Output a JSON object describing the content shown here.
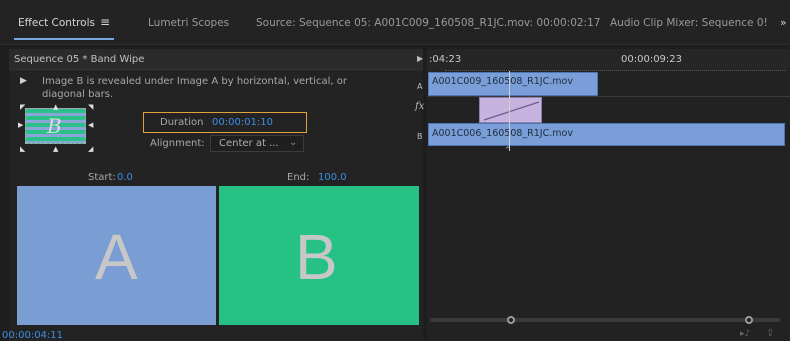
{
  "tabs": {
    "effect_controls": "Effect Controls",
    "menu_glyph": "≡",
    "lumetri": "Lumetri Scopes",
    "source": "Source: Sequence 05: A001C009_160508_R1JC.mov: 00:00:02:17",
    "audio_mixer": "Audio Clip Mixer: Sequence 0!",
    "overflow": "»"
  },
  "effect": {
    "sequence_label": "Sequence 05 * Band Wipe",
    "description": "Image B is revealed under Image A by horizontal, vertical, or diagonal bars.",
    "duration_label": "Duration",
    "duration_value": "00:00:01:10",
    "alignment_label": "Alignment:",
    "alignment_value": "Center at ...",
    "thumbnail_letter": "B",
    "start_label": "Start:",
    "start_value": "0.0",
    "end_label": "End:",
    "end_value": "100.0",
    "preview_a": "A",
    "preview_b": "B",
    "timecode": "00:00:04:11"
  },
  "timeline": {
    "ruler_left": ":04:23",
    "ruler_right": "00:00:09:23",
    "track_a": "A",
    "track_fx": "fx",
    "track_b": "B",
    "clip_a": "A001C009_160508_R1JC.mov",
    "clip_b": "A001C006_160508_R1JC.mov"
  },
  "colors": {
    "accent_blue": "#3a8ee6",
    "highlight_orange": "#e0a23a",
    "preview_a": "#7a9dd4",
    "preview_b": "#26c285",
    "clip": "#7a9ed8",
    "transition": "#c6b3de"
  }
}
